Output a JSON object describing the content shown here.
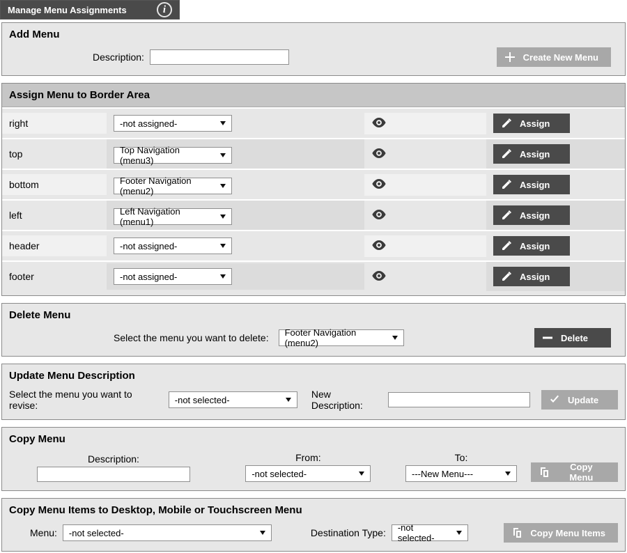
{
  "titleBar": {
    "label": "Manage Menu Assignments"
  },
  "addMenu": {
    "title": "Add Menu",
    "descriptionLabel": "Description:",
    "descriptionValue": "",
    "button": "Create New Menu"
  },
  "assign": {
    "title": "Assign Menu to Border Area",
    "assignLabel": "Assign",
    "rows": [
      {
        "area": "right",
        "selected": "-not assigned-"
      },
      {
        "area": "top",
        "selected": "Top Navigation (menu3)"
      },
      {
        "area": "bottom",
        "selected": "Footer Navigation (menu2)"
      },
      {
        "area": "left",
        "selected": "Left Navigation (menu1)"
      },
      {
        "area": "header",
        "selected": "-not assigned-"
      },
      {
        "area": "footer",
        "selected": "-not assigned-"
      }
    ]
  },
  "deleteMenu": {
    "title": "Delete Menu",
    "prompt": "Select the menu you want to delete:",
    "selected": "Footer Navigation (menu2)",
    "button": "Delete"
  },
  "updateMenu": {
    "title": "Update Menu Description",
    "prompt": "Select the menu you want to revise:",
    "selected": "-not selected-",
    "newDescLabel": "New Description:",
    "newDescValue": "",
    "button": "Update"
  },
  "copyMenu": {
    "title": "Copy Menu",
    "descriptionLabel": "Description:",
    "descriptionValue": "",
    "fromLabel": "From:",
    "fromSelected": "-not selected-",
    "toLabel": "To:",
    "toSelected": "---New Menu---",
    "button": "Copy Menu"
  },
  "copyItems": {
    "title": "Copy Menu Items to Desktop, Mobile or Touchscreen Menu",
    "menuLabel": "Menu:",
    "menuSelected": "-not selected-",
    "destLabel": "Destination Type:",
    "destSelected": "-not selected-",
    "button": "Copy Menu Items"
  }
}
